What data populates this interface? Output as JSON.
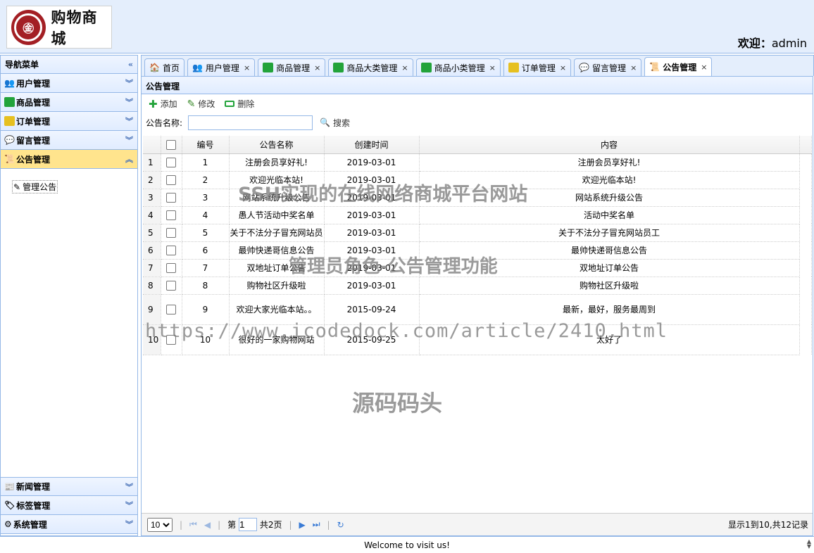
{
  "header": {
    "logo_text": "购物商城",
    "welcome_label": "欢迎：",
    "username": "admin"
  },
  "sidebar": {
    "title": "导航菜单",
    "collapse_icon": "double-chevron-left-icon",
    "items": [
      {
        "label": "用户管理",
        "icon": "users-icon",
        "color": "#d48a2a"
      },
      {
        "label": "商品管理",
        "icon": "list-icon",
        "color": "#22a33a"
      },
      {
        "label": "订单管理",
        "icon": "order-icon",
        "color": "#e6c020"
      },
      {
        "label": "留言管理",
        "icon": "speech-bubble-icon",
        "color": "#333333"
      },
      {
        "label": "公告管理",
        "icon": "notice-icon",
        "color": "#555555",
        "active": true
      }
    ],
    "sub_items": [
      {
        "label": "管理公告",
        "icon": "edit-icon"
      }
    ],
    "bottom_items": [
      {
        "label": "新闻管理",
        "icon": "news-icon"
      },
      {
        "label": "标签管理",
        "icon": "tag-icon"
      },
      {
        "label": "系统管理",
        "icon": "gear-icon"
      }
    ]
  },
  "tabs": [
    {
      "label": "首页",
      "icon": "home-icon",
      "closable": false
    },
    {
      "label": "用户管理",
      "icon": "users-icon",
      "closable": true
    },
    {
      "label": "商品管理",
      "icon": "list-icon",
      "closable": true
    },
    {
      "label": "商品大类管理",
      "icon": "list-icon",
      "closable": true
    },
    {
      "label": "商品小类管理",
      "icon": "list-icon",
      "closable": true
    },
    {
      "label": "订单管理",
      "icon": "order-icon",
      "closable": true
    },
    {
      "label": "留言管理",
      "icon": "speech-bubble-icon",
      "closable": true
    },
    {
      "label": "公告管理",
      "icon": "notice-icon",
      "closable": true,
      "active": true
    }
  ],
  "panel": {
    "title": "公告管理"
  },
  "toolbar": {
    "add_label": "添加",
    "edit_label": "修改",
    "delete_label": "删除"
  },
  "search": {
    "label": "公告名称:",
    "value": "",
    "button_label": "搜索"
  },
  "grid": {
    "columns": [
      "编号",
      "公告名称",
      "创建时间",
      "内容"
    ],
    "rows": [
      {
        "n": "1",
        "id": "1",
        "name": "注册会员享好礼!",
        "date": "2019-03-01",
        "content": "注册会员享好礼!"
      },
      {
        "n": "2",
        "id": "2",
        "name": "欢迎光临本站!",
        "date": "2019-03-01",
        "content": "欢迎光临本站!"
      },
      {
        "n": "3",
        "id": "3",
        "name": "网站系统升级公告",
        "date": "2019-03-01",
        "content": "网站系统升级公告"
      },
      {
        "n": "4",
        "id": "4",
        "name": "愚人节活动中奖名单",
        "date": "2019-03-01",
        "content": "活动中奖名单"
      },
      {
        "n": "5",
        "id": "5",
        "name": "关于不法分子冒充网站员",
        "date": "2019-03-01",
        "content": "关于不法分子冒充网站员工"
      },
      {
        "n": "6",
        "id": "6",
        "name": "最帅快递哥信息公告",
        "date": "2019-03-01",
        "content": "最帅快递哥信息公告"
      },
      {
        "n": "7",
        "id": "7",
        "name": "双地址订单公告",
        "date": "2019-03-01",
        "content": "双地址订单公告"
      },
      {
        "n": "8",
        "id": "8",
        "name": "购物社区升级啦",
        "date": "2019-03-01",
        "content": "购物社区升级啦"
      },
      {
        "n": "9",
        "id": "9",
        "name": "欢迎大家光临本站。。",
        "date": "2015-09-24",
        "content": "最新，最好，服务最周到"
      },
      {
        "n": "10",
        "id": "10",
        "name": "很好的一家购物网站",
        "date": "2015-09-25",
        "content": "太好了"
      }
    ]
  },
  "pager": {
    "page_size": "10",
    "page_prefix": "第",
    "page": "1",
    "total_pages": "共2页",
    "info": "显示1到10,共12记录"
  },
  "footer": {
    "text": "Welcome to visit us!"
  },
  "watermarks": {
    "line1": "SSH实现的在线网络商城平台网站",
    "line2": "管理员角色-公告管理功能",
    "url": "https://www.icodedock.com/article/2410.html",
    "brand": "源码码头"
  }
}
